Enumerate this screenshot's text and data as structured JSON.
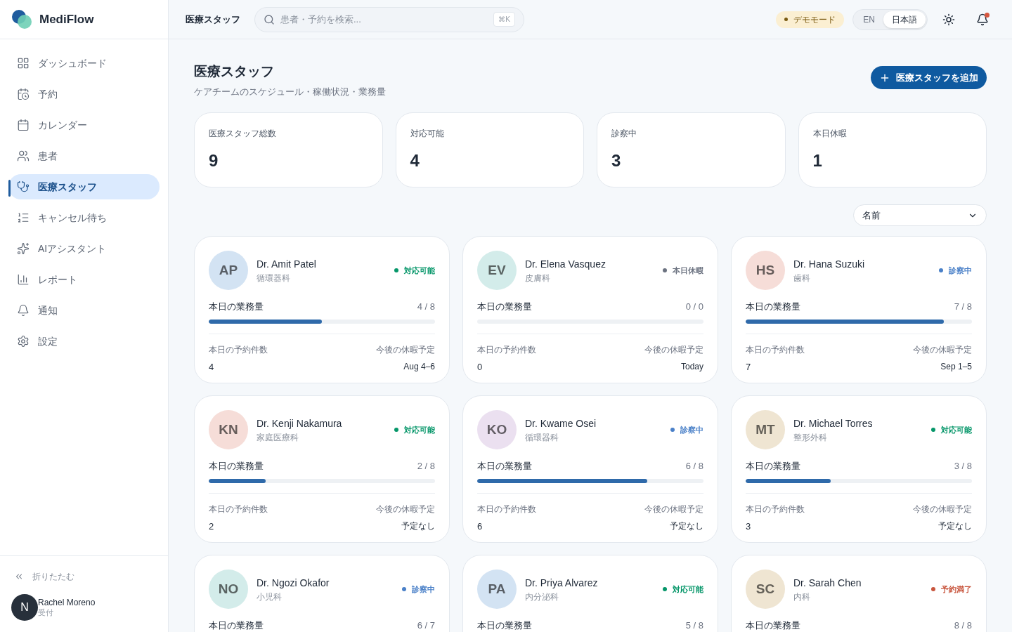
{
  "brand": {
    "name": "MediFlow"
  },
  "sidebar": {
    "items": [
      {
        "label": "ダッシュボード",
        "selected": false
      },
      {
        "label": "予約",
        "selected": false
      },
      {
        "label": "カレンダー",
        "selected": false
      },
      {
        "label": "患者",
        "selected": false
      },
      {
        "label": "医療スタッフ",
        "selected": true
      },
      {
        "label": "キャンセル待ち",
        "selected": false
      },
      {
        "label": "AIアシスタント",
        "selected": false
      },
      {
        "label": "レポート",
        "selected": false
      },
      {
        "label": "通知",
        "selected": false
      },
      {
        "label": "設定",
        "selected": false
      }
    ],
    "collapse": "折りたたむ",
    "user": {
      "initial": "N",
      "name": "Rachel Moreno",
      "role": "受付"
    }
  },
  "topbar": {
    "breadcrumb": "医療スタッフ",
    "search": {
      "placeholder": "患者・予約を検索...",
      "shortcut": "⌘K"
    },
    "demo_badge": "デモモード",
    "languages": [
      {
        "label": "EN",
        "selected": false
      },
      {
        "label": "日本語",
        "selected": true
      }
    ],
    "has_notification": true
  },
  "page": {
    "title": "医療スタッフ",
    "subtitle": "ケアチームのスケジュール・稼働状況・業務量",
    "add_button": "医療スタッフを追加"
  },
  "stats": [
    {
      "label": "医療スタッフ総数",
      "value": "9"
    },
    {
      "label": "対応可能",
      "value": "4"
    },
    {
      "label": "診察中",
      "value": "3"
    },
    {
      "label": "本日休暇",
      "value": "1"
    }
  ],
  "sort": {
    "value": "名前"
  },
  "staff": [
    {
      "avatar": {
        "initials": "AP",
        "color": "#d3e3f3"
      },
      "name": "Dr. Amit Patel",
      "specialty": "循環器科",
      "status": "対応可能",
      "color": "#059669",
      "workload_label": "本日の業務量",
      "workload": "4 / 8",
      "level": 0.5,
      "appointments_label": "本日の予約件数",
      "appointments": "4",
      "leave_label": "今後の休暇予定",
      "leave": "Aug 4–6"
    },
    {
      "avatar": {
        "initials": "EV",
        "color": "#d3ecea"
      },
      "name": "Dr. Elena Vasquez",
      "specialty": "皮膚科",
      "status": "本日休暇",
      "color": "#6b7280",
      "workload_label": "本日の業務量",
      "workload": "0 / 0",
      "appointments_label": "本日の予約件数",
      "appointments": "0",
      "leave_label": "今後の休暇予定",
      "leave": "Today"
    },
    {
      "avatar": {
        "initials": "HS",
        "color": "#f6ddd8"
      },
      "name": "Dr. Hana Suzuki",
      "specialty": "歯科",
      "status": "診察中",
      "color": "#4a80c8",
      "workload_label": "本日の業務量",
      "workload": "7 / 8",
      "level": 0.875,
      "appointments_label": "本日の予約件数",
      "appointments": "7",
      "leave_label": "今後の休暇予定",
      "leave": "Sep 1–5"
    },
    {
      "avatar": {
        "initials": "KN",
        "color": "#f6ddd8"
      },
      "name": "Dr. Kenji Nakamura",
      "specialty": "家庭医療科",
      "status": "対応可能",
      "color": "#059669",
      "workload_label": "本日の業務量",
      "workload": "2 / 8",
      "level": 0.25,
      "appointments_label": "本日の予約件数",
      "appointments": "2",
      "leave_label": "今後の休暇予定",
      "leave": "予定なし"
    },
    {
      "avatar": {
        "initials": "KO",
        "color": "#ebe0f0"
      },
      "name": "Dr. Kwame Osei",
      "specialty": "循環器科",
      "status": "診察中",
      "color": "#4a80c8",
      "workload_label": "本日の業務量",
      "workload": "6 / 8",
      "level": 0.75,
      "appointments_label": "本日の予約件数",
      "appointments": "6",
      "leave_label": "今後の休暇予定",
      "leave": "予定なし"
    },
    {
      "avatar": {
        "initials": "MT",
        "color": "#efe5d2"
      },
      "name": "Dr. Michael Torres",
      "specialty": "整形外科",
      "status": "対応可能",
      "color": "#059669",
      "workload_label": "本日の業務量",
      "workload": "3 / 8",
      "level": 0.375,
      "appointments_label": "本日の予約件数",
      "appointments": "3",
      "leave_label": "今後の休暇予定",
      "leave": "予定なし"
    },
    {
      "avatar": {
        "initials": "NO",
        "color": "#d3ecea"
      },
      "name": "Dr. Ngozi Okafor",
      "specialty": "小児科",
      "status": "診察中",
      "color": "#4a80c8",
      "workload_label": "本日の業務量",
      "workload": "6 / 7"
    },
    {
      "avatar": {
        "initials": "PA",
        "color": "#d3e3f3"
      },
      "name": "Dr. Priya Alvarez",
      "specialty": "内分泌科",
      "status": "対応可能",
      "color": "#059669",
      "workload_label": "本日の業務量",
      "workload": "5 / 8"
    },
    {
      "avatar": {
        "initials": "SC",
        "color": "#efe5d2"
      },
      "name": "Dr. Sarah Chen",
      "specialty": "内科",
      "status": "予約満了",
      "color": "#c8553d",
      "workload_label": "本日の業務量",
      "workload": "8 / 8"
    }
  ]
}
